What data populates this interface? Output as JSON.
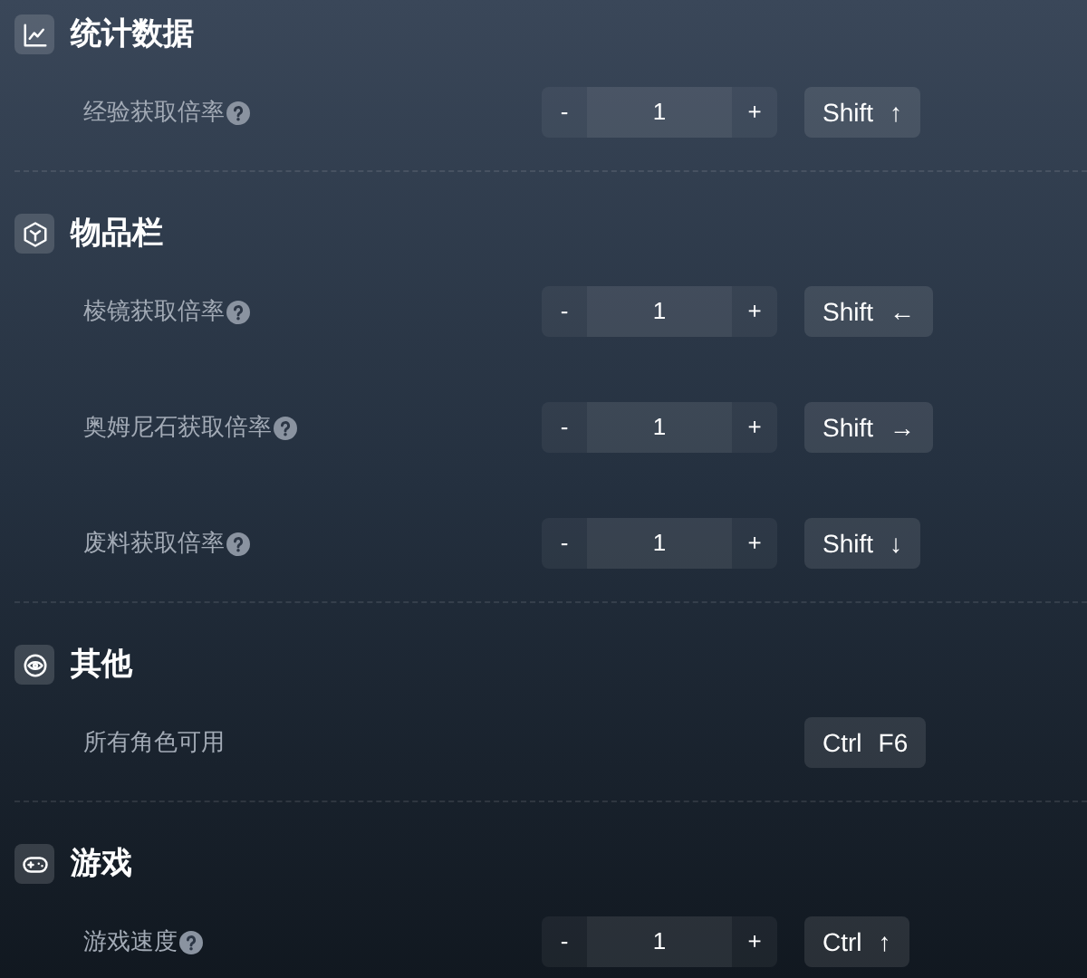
{
  "sections": [
    {
      "title": "统计数据",
      "rows": [
        {
          "kind": "stepper",
          "label": "经验获取倍率",
          "help": true,
          "value": "1",
          "minus": "-",
          "plus": "+",
          "keys": [
            "Shift",
            "↑"
          ]
        }
      ]
    },
    {
      "title": "物品栏",
      "rows": [
        {
          "kind": "stepper",
          "label": "棱镜获取倍率",
          "help": true,
          "value": "1",
          "minus": "-",
          "plus": "+",
          "keys": [
            "Shift",
            "←"
          ]
        },
        {
          "kind": "stepper",
          "label": "奥姆尼石获取倍率",
          "help": true,
          "value": "1",
          "minus": "-",
          "plus": "+",
          "keys": [
            "Shift",
            "→"
          ]
        },
        {
          "kind": "stepper",
          "label": "废料获取倍率",
          "help": true,
          "value": "1",
          "minus": "-",
          "plus": "+",
          "keys": [
            "Shift",
            "↓"
          ]
        }
      ]
    },
    {
      "title": "其他",
      "rows": [
        {
          "kind": "action",
          "label": "所有角色可用",
          "help": false,
          "keys": [
            "Ctrl",
            "F6"
          ]
        }
      ]
    },
    {
      "title": "游戏",
      "rows": [
        {
          "kind": "stepper",
          "label": "游戏速度",
          "help": true,
          "value": "1",
          "minus": "-",
          "plus": "+",
          "keys": [
            "Ctrl",
            "↑"
          ]
        }
      ]
    }
  ]
}
